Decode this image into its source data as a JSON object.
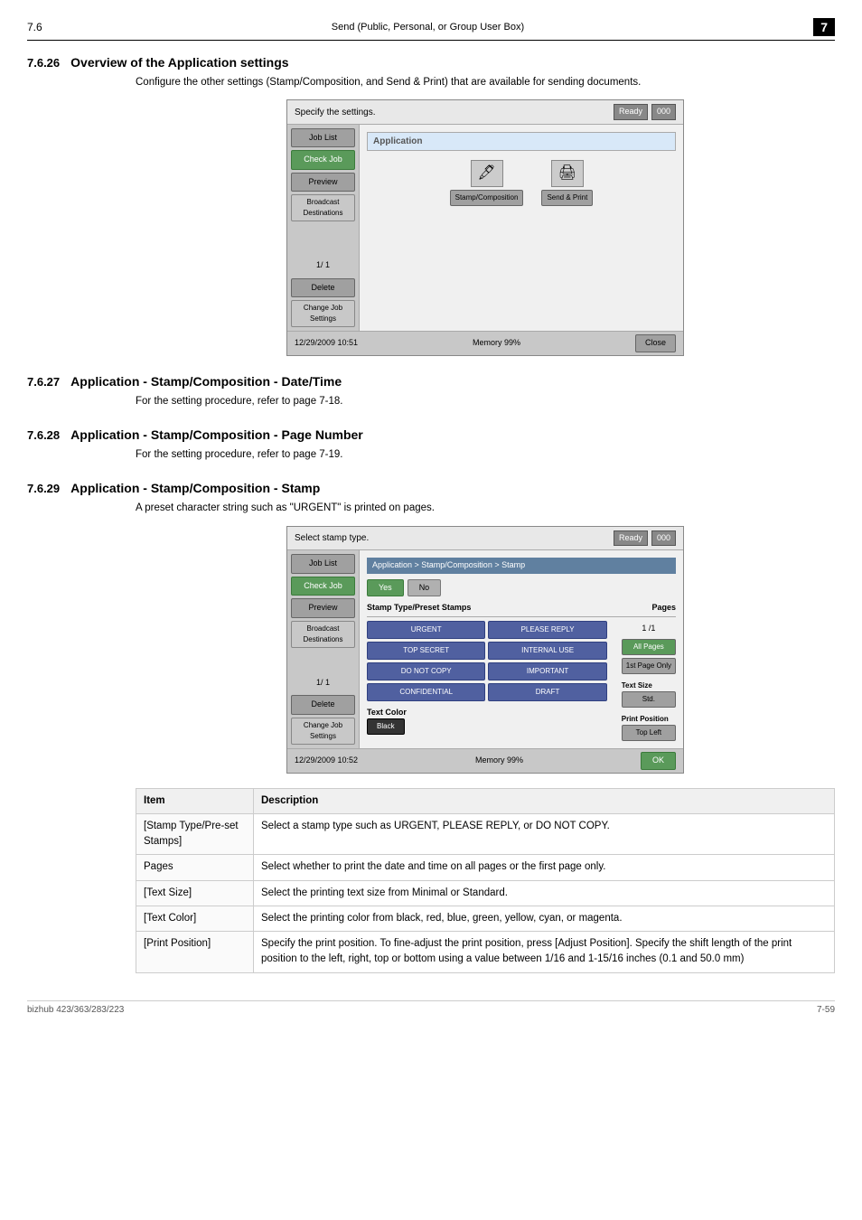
{
  "header": {
    "section_ref": "7.6",
    "section_title": "Send (Public, Personal, or Group User Box)",
    "page_num": "7"
  },
  "sections": [
    {
      "num": "7.6.26",
      "title": "Overview of the Application settings",
      "body": "Configure the other settings (Stamp/Composition, and Send & Print) that are available for sending documents.",
      "has_ui": true,
      "ui_type": "application"
    },
    {
      "num": "7.6.27",
      "title": "Application - Stamp/Composition - Date/Time",
      "body": "For the setting procedure, refer to page 7-18.",
      "has_ui": false
    },
    {
      "num": "7.6.28",
      "title": "Application - Stamp/Composition - Page Number",
      "body": "For the setting procedure, refer to page 7-19.",
      "has_ui": false
    },
    {
      "num": "7.6.29",
      "title": "Application - Stamp/Composition - Stamp",
      "body": "A preset character string such as \"URGENT\" is printed on pages.",
      "has_ui": true,
      "ui_type": "stamp"
    }
  ],
  "ui_application": {
    "top_bar_text": "Specify the settings.",
    "status_label": "000",
    "sidebar_buttons": [
      "Job List",
      "Check Job",
      "Preview",
      "Broadcast\nDestinations",
      "1/ 1",
      "Delete",
      "Change Job\nSettings"
    ],
    "content_title": "Application",
    "icons": [
      {
        "label": "Stamp/Composition",
        "icon": "🖋"
      },
      {
        "label": "Send & Print",
        "icon": "🖨"
      }
    ],
    "bottom_time": "12/29/2009   10:51",
    "bottom_mem": "Memory   99%",
    "close_btn": "Close"
  },
  "ui_stamp": {
    "top_bar_text": "Select stamp type.",
    "status_label": "000",
    "sidebar_buttons": [
      "Job List",
      "Check Job",
      "Preview",
      "Broadcast\nDestinations",
      "1/ 1",
      "Delete",
      "Change Job\nSettings"
    ],
    "breadcrumb": "Application > Stamp/Composition > Stamp",
    "yes_btn": "Yes",
    "no_btn": "No",
    "stamp_type_label": "Stamp Type/Preset Stamps",
    "pages_label": "Pages",
    "stamp_buttons": [
      "URGENT",
      "PLEASE REPLY",
      "TOP SECRET",
      "INTERNAL USE",
      "DO NOT COPY",
      "IMPORTANT",
      "CONFIDENTIAL",
      "DRAFT"
    ],
    "page_num_display": "1  /1",
    "page_btns": [
      "All Pages",
      "1st Page Only"
    ],
    "text_size_label": "Text Size",
    "text_size_val": "Std.",
    "print_position_label": "Print Position",
    "print_position_val": "Top Left",
    "text_color_label": "Text Color",
    "text_color_val": "Black",
    "ok_btn": "OK",
    "bottom_time": "12/29/2009   10:52",
    "bottom_mem": "Memory   99%"
  },
  "table": {
    "headers": [
      "Item",
      "Description"
    ],
    "rows": [
      {
        "item": "[Stamp Type/Pre-set Stamps]",
        "desc": "Select a stamp type such as URGENT, PLEASE REPLY, or DO NOT COPY."
      },
      {
        "item": "Pages",
        "desc": "Select whether to print the date and time on all pages or the first page only."
      },
      {
        "item": "[Text Size]",
        "desc": "Select the printing text size from Minimal or Standard."
      },
      {
        "item": "[Text Color]",
        "desc": "Select the printing color from black, red, blue, green, yellow, cyan, or magenta."
      },
      {
        "item": "[Print Position]",
        "desc": "Specify the print position. To fine-adjust the print position, press [Adjust Position]. Specify the shift length of the print position to the left, right, top or bottom using a value between 1/16 and 1-15/16 inches (0.1 and 50.0 mm)"
      }
    ]
  },
  "footer": {
    "left": "bizhub 423/363/283/223",
    "right": "7-59"
  }
}
